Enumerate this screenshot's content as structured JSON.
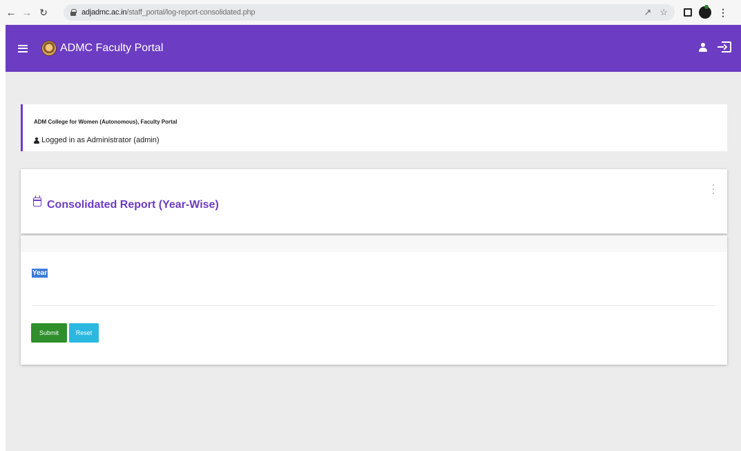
{
  "browser": {
    "url_domain": "adjadmc.ac.in",
    "url_path": "/staff_portal/log-report-consolidated.php",
    "icons": [
      "back-arrow-icon",
      "forward-arrow-icon",
      "reload-icon",
      "lock-icon",
      "share-icon",
      "star-icon",
      "tab-square-icon",
      "profile-icon",
      "kebab-menu-icon"
    ]
  },
  "appbar": {
    "title": "ADMC Faculty Portal",
    "color": "#6c3cc3"
  },
  "info": {
    "college": "ADM College for Women (Autonomous), Faculty Portal",
    "logged_in": "Logged in as Administrator (admin)"
  },
  "report": {
    "title": "Consolidated Report (Year-Wise)"
  },
  "form": {
    "year_label": "Year",
    "submit_label": "Submit",
    "reset_label": "Reset",
    "submit_color": "#2e8f2c",
    "reset_color": "#2ab8e0"
  }
}
